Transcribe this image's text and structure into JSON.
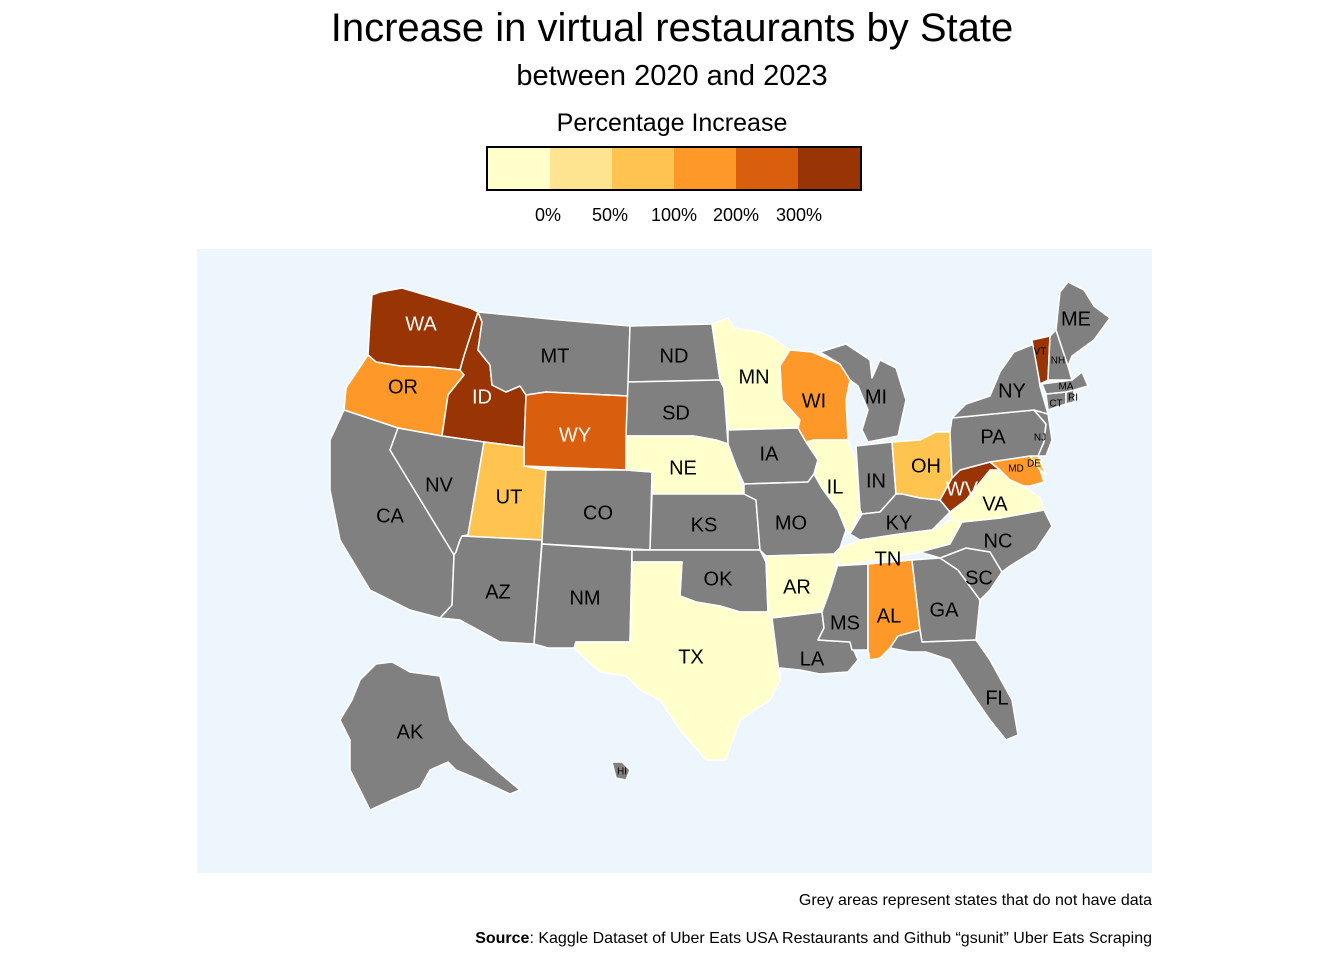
{
  "title": "Increase in virtual restaurants by State",
  "subtitle": "between 2020 and 2023",
  "legend": {
    "title": "Percentage Increase",
    "bins": [
      "#ffffcc",
      "#fee391",
      "#fec44f",
      "#fe9929",
      "#d95f0e",
      "#993404"
    ],
    "ticks": [
      "0%",
      "50%",
      "100%",
      "200%",
      "300%"
    ]
  },
  "colors": {
    "no_data": "#808080",
    "background": "#eef6fd",
    "border": "#ffffff"
  },
  "states": {
    "WA": {
      "label": "WA",
      "bin": 5
    },
    "OR": {
      "label": "OR",
      "bin": 3
    },
    "ID": {
      "label": "ID",
      "bin": 5
    },
    "WY": {
      "label": "WY",
      "bin": 4
    },
    "UT": {
      "label": "UT",
      "bin": 2
    },
    "WI": {
      "label": "WI",
      "bin": 3
    },
    "OH": {
      "label": "OH",
      "bin": 2
    },
    "WV": {
      "label": "WV",
      "bin": 5
    },
    "VT": {
      "label": "VT",
      "bin": 5
    },
    "MD": {
      "label": "MD",
      "bin": 3
    },
    "DE": {
      "label": "DE",
      "bin": 2
    },
    "AL": {
      "label": "AL",
      "bin": 3
    },
    "MN": {
      "label": "MN",
      "bin": 0
    },
    "NE": {
      "label": "NE",
      "bin": 0
    },
    "IL": {
      "label": "IL",
      "bin": 0
    },
    "TX": {
      "label": "TX",
      "bin": 0
    },
    "AR": {
      "label": "AR",
      "bin": 0
    },
    "TN": {
      "label": "TN",
      "bin": 0
    },
    "VA": {
      "label": "VA",
      "bin": 0
    },
    "MT": {
      "label": "MT",
      "bin": null
    },
    "ND": {
      "label": "ND",
      "bin": null
    },
    "SD": {
      "label": "SD",
      "bin": null
    },
    "CA": {
      "label": "CA",
      "bin": null
    },
    "NV": {
      "label": "NV",
      "bin": null
    },
    "AZ": {
      "label": "AZ",
      "bin": null
    },
    "CO": {
      "label": "CO",
      "bin": null
    },
    "NM": {
      "label": "NM",
      "bin": null
    },
    "KS": {
      "label": "KS",
      "bin": null
    },
    "OK": {
      "label": "OK",
      "bin": null
    },
    "IA": {
      "label": "IA",
      "bin": null
    },
    "MO": {
      "label": "MO",
      "bin": null
    },
    "LA": {
      "label": "LA",
      "bin": null
    },
    "MS": {
      "label": "MS",
      "bin": null
    },
    "MI": {
      "label": "MI",
      "bin": null
    },
    "IN": {
      "label": "IN",
      "bin": null
    },
    "KY": {
      "label": "KY",
      "bin": null
    },
    "GA": {
      "label": "GA",
      "bin": null
    },
    "FL": {
      "label": "FL",
      "bin": null
    },
    "SC": {
      "label": "SC",
      "bin": null
    },
    "NC": {
      "label": "NC",
      "bin": null
    },
    "PA": {
      "label": "PA",
      "bin": null
    },
    "NY": {
      "label": "NY",
      "bin": null
    },
    "NJ": {
      "label": "NJ",
      "bin": null
    },
    "ME": {
      "label": "ME",
      "bin": null
    },
    "NH": {
      "label": "NH",
      "bin": null
    },
    "MA": {
      "label": "MA",
      "bin": null
    },
    "CT": {
      "label": "CT",
      "bin": null
    },
    "RI": {
      "label": "RI",
      "bin": null
    },
    "AK": {
      "label": "AK",
      "bin": null
    },
    "HI": {
      "label": "HI",
      "bin": null
    }
  },
  "footnote": "Grey areas represent states that do not have data",
  "source": {
    "label": "Source",
    "text": ": Kaggle Dataset of Uber Eats USA Restaurants and Github “gsunit” Uber Eats Scraping"
  }
}
